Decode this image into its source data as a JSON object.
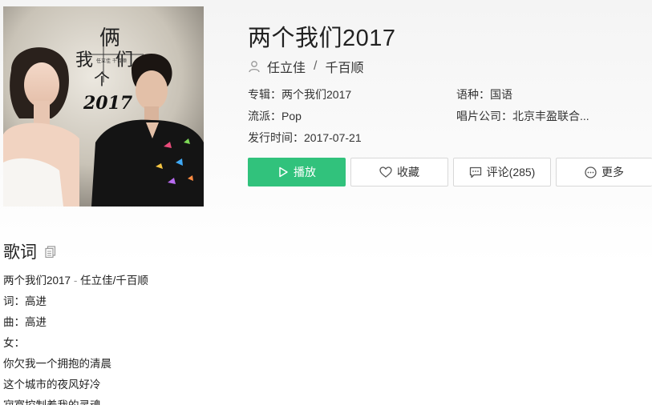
{
  "song": {
    "title": "两个我们2017",
    "artists": [
      "任立佳",
      "千百顺"
    ],
    "artist_separator": "/"
  },
  "meta": {
    "album_label": "专辑：",
    "album_value": "两个我们2017",
    "language_label": "语种：",
    "language_value": "国语",
    "genre_label": "流派：",
    "genre_value": "Pop",
    "company_label": "唱片公司：",
    "company_value": "北京丰盈联合...",
    "release_label": "发行时间：",
    "release_value": "2017-07-21"
  },
  "buttons": {
    "play": "播放",
    "favorite": "收藏",
    "comment": "评论(285)",
    "more": "更多"
  },
  "cover": {
    "text_liang": "俩",
    "text_wo": "我",
    "text_men": "们",
    "text_ge": "个",
    "text_year": "2017",
    "small_text": "任立佳 千百顺"
  },
  "lyrics": {
    "heading": "歌词",
    "header_song": "两个我们2017",
    "header_dash": "-",
    "header_artists": "任立佳/千百顺",
    "lines": [
      "词：高进",
      "曲：高进",
      "女：",
      "你欠我一个拥抱的清晨",
      "这个城市的夜风好冷",
      "寂寞控制着我的灵魂"
    ]
  },
  "colors": {
    "accent_green": "#31c27c",
    "border": "#d8d8d8"
  },
  "icons": {
    "artist": "user-icon",
    "play": "play-icon",
    "favorite": "heart-icon",
    "comment": "comment-icon",
    "more": "more-icon",
    "copy": "copy-icon"
  }
}
